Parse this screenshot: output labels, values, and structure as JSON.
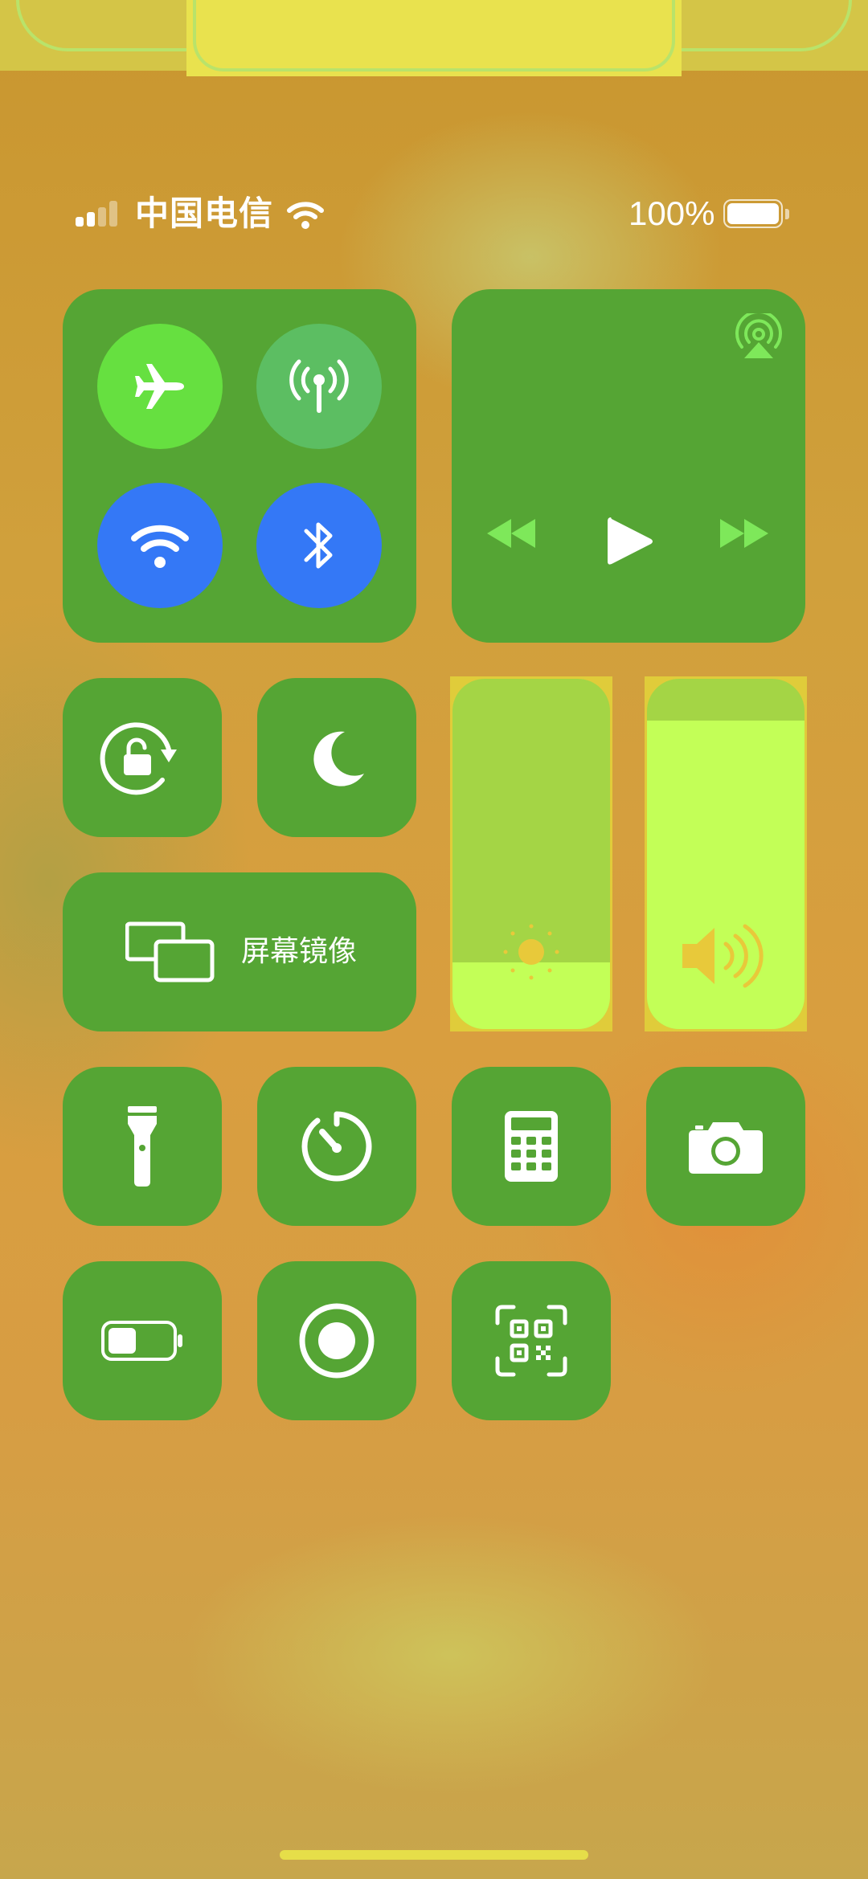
{
  "status_bar": {
    "carrier": "中国电信",
    "battery_percent": "100%",
    "signal_bars_filled": 2,
    "signal_bars_total": 4,
    "battery_level": 1.0
  },
  "connectivity": {
    "airplane_mode": true,
    "cellular_data": false,
    "wifi": true,
    "bluetooth": true
  },
  "media": {
    "state": "paused"
  },
  "controls": {
    "screen_mirroring_label": "屏幕镜像"
  },
  "sliders": {
    "brightness_level": 0.19,
    "volume_level": 0.88
  },
  "colors": {
    "tile_green": "#55a534",
    "airplane_on": "#66e040",
    "cellular_off": "#5cbe62",
    "wifi_bt_on": "#3478f6",
    "slider_fill": "#c3ff57",
    "slider_track": "#a4d545"
  },
  "icons": [
    "airplane-icon",
    "cellular-icon",
    "wifi-icon",
    "bluetooth-icon",
    "airplay-icon",
    "rewind-icon",
    "play-icon",
    "fast-forward-icon",
    "rotation-lock-icon",
    "moon-icon",
    "screen-mirroring-icon",
    "brightness-icon",
    "volume-icon",
    "flashlight-icon",
    "timer-icon",
    "calculator-icon",
    "camera-icon",
    "low-power-icon",
    "screen-record-icon",
    "qr-scanner-icon"
  ]
}
